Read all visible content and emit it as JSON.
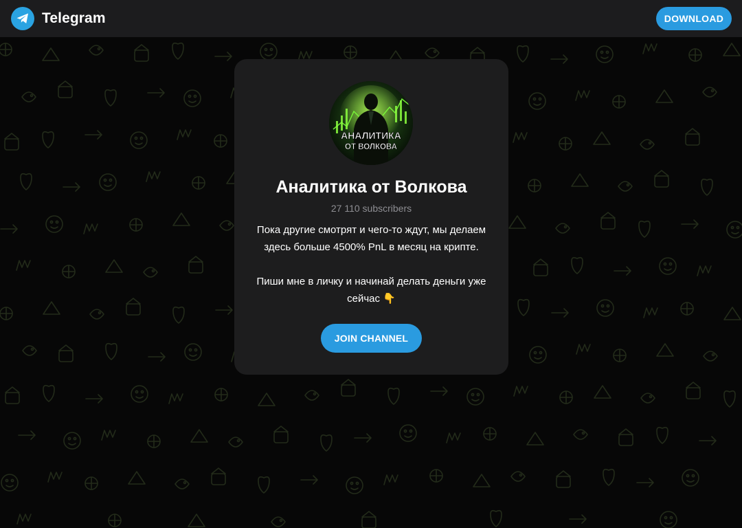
{
  "header": {
    "app_name": "Telegram",
    "download_label": "DOWNLOAD"
  },
  "channel": {
    "avatar_text_line1": "АНАЛИТИКА",
    "avatar_text_line2": "ОТ ВОЛКОВА",
    "title": "Аналитика от Волкова",
    "subscribers": "27 110 subscribers",
    "description_paragraph_1": "Пока другие смотрят и чего-то ждут, мы делаем здесь больше 4500% PnL в месяц на крипте.",
    "description_paragraph_2": "Пиши мне в личку и начинай делать деньги уже сейчас 👇",
    "join_label": "JOIN CHANNEL"
  },
  "colors": {
    "accent": "#2a9be0",
    "card_background": "#1d1d1e",
    "topbar_background": "#1c1c1e",
    "page_background": "#070707",
    "pattern_color": "#2e3a22"
  }
}
